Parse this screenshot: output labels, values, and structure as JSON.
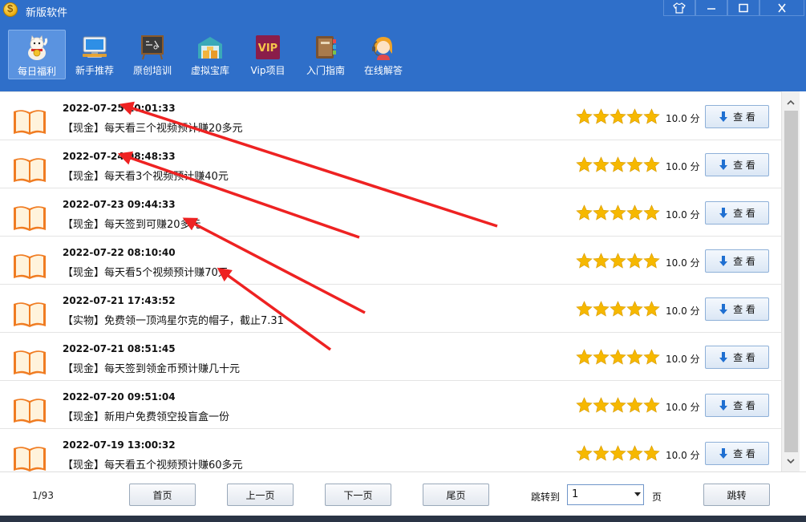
{
  "window": {
    "title": "新版软件",
    "controls": [
      "shirt-icon",
      "minimize-icon",
      "maximize-icon",
      "close-icon"
    ]
  },
  "toolbar": {
    "items": [
      {
        "label": "每日福利",
        "icon": "lucky-cat-icon",
        "active": true
      },
      {
        "label": "新手推荐",
        "icon": "monitor-icon",
        "active": false
      },
      {
        "label": "原创培训",
        "icon": "chalkboard-icon",
        "active": false
      },
      {
        "label": "虚拟宝库",
        "icon": "warehouse-icon",
        "active": false
      },
      {
        "label": "Vip项目",
        "icon": "vip-icon",
        "active": false
      },
      {
        "label": "入门指南",
        "icon": "notebook-icon",
        "active": false
      },
      {
        "label": "在线解答",
        "icon": "support-agent-icon",
        "active": false
      }
    ],
    "vip_badge": "VIP"
  },
  "list": {
    "items": [
      {
        "date": "2022-07-25 10:01:33",
        "title": "【现金】每天看三个视频预计赚20多元",
        "rating": 5,
        "score": "10.0 分",
        "button": "查 看"
      },
      {
        "date": "2022-07-24 08:48:33",
        "title": "【现金】每天看3个视频预计赚40元",
        "rating": 5,
        "score": "10.0 分",
        "button": "查 看"
      },
      {
        "date": "2022-07-23 09:44:33",
        "title": "【现金】每天签到可赚20多元",
        "rating": 5,
        "score": "10.0 分",
        "button": "查 看"
      },
      {
        "date": "2022-07-22 08:10:40",
        "title": "【现金】每天看5个视频预计赚70元",
        "rating": 5,
        "score": "10.0 分",
        "button": "查 看"
      },
      {
        "date": "2022-07-21 17:43:52",
        "title": "【实物】免费领一顶鸿星尔克的帽子，截止7.31",
        "rating": 5,
        "score": "10.0 分",
        "button": "查 看"
      },
      {
        "date": "2022-07-21 08:51:45",
        "title": "【现金】每天签到领金币预计赚几十元",
        "rating": 5,
        "score": "10.0 分",
        "button": "查 看"
      },
      {
        "date": "2022-07-20 09:51:04",
        "title": "【现金】新用户免费领空投盲盒一份",
        "rating": 5,
        "score": "10.0 分",
        "button": "查 看"
      },
      {
        "date": "2022-07-19 13:00:32",
        "title": "【现金】每天看五个视频预计赚60多元",
        "rating": 5,
        "score": "10.0 分",
        "button": "查 看"
      }
    ]
  },
  "pager": {
    "info": "1/93",
    "first": "首页",
    "prev": "上一页",
    "next": "下一页",
    "last": "尾页",
    "jump_label": "跳转到",
    "jump_value": "1",
    "unit": "页",
    "jump_button": "跳转"
  },
  "colors": {
    "titlebar": "#2f6fc9",
    "star": "#f6b800",
    "annotation": "#ee2222"
  }
}
